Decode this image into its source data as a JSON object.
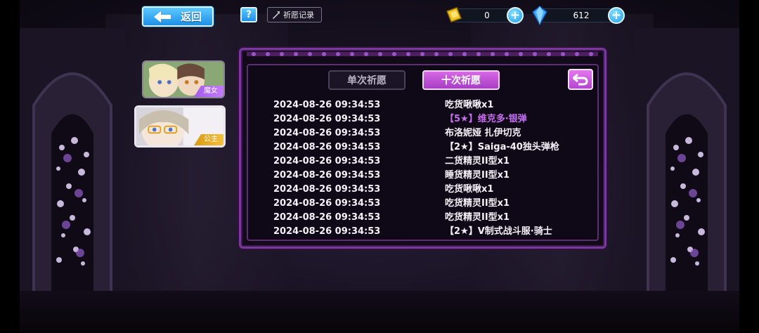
{
  "topbar": {
    "back_label": "返回",
    "help_label": "?",
    "record_label": "祈愿记录"
  },
  "currency": {
    "gold": {
      "value": "0",
      "icon": "gold-ticket-icon",
      "color": "#f2c31a"
    },
    "gem": {
      "value": "612",
      "icon": "blue-crystal-icon",
      "color": "#3fa8ff"
    }
  },
  "characters": [
    {
      "tag": "魔女",
      "tag_color": "#b46cf2"
    },
    {
      "tag": "公主",
      "tag_color": "#f0b21f"
    }
  ],
  "tabs": {
    "single": "单次祈愿",
    "ten": "十次祈愿",
    "active": "ten"
  },
  "records": [
    {
      "time": "2024-08-26 09:34:53",
      "item": "吃货啾啾x1",
      "rare": false
    },
    {
      "time": "2024-08-26 09:34:53",
      "item": "【5★】维克多·银弹",
      "rare": true
    },
    {
      "time": "2024-08-26 09:34:53",
      "item": "布洛妮娅 扎伊切克",
      "rare": false
    },
    {
      "time": "2024-08-26 09:34:53",
      "item": "【2★】Saiga-40独头弹枪",
      "rare": false
    },
    {
      "time": "2024-08-26 09:34:53",
      "item": "二货精灵II型x1",
      "rare": false
    },
    {
      "time": "2024-08-26 09:34:53",
      "item": "睡货精灵II型x1",
      "rare": false
    },
    {
      "time": "2024-08-26 09:34:53",
      "item": "吃货啾啾x1",
      "rare": false
    },
    {
      "time": "2024-08-26 09:34:53",
      "item": "吃货精灵II型x1",
      "rare": false
    },
    {
      "time": "2024-08-26 09:34:53",
      "item": "吃货精灵II型x1",
      "rare": false
    },
    {
      "time": "2024-08-26 09:34:53",
      "item": "【2★】V制式战斗服·骑士",
      "rare": false
    }
  ],
  "colors": {
    "accent_blue": "#2aa3f0",
    "accent_purple": "#c056e0",
    "rare_text": "#c66ef0"
  }
}
